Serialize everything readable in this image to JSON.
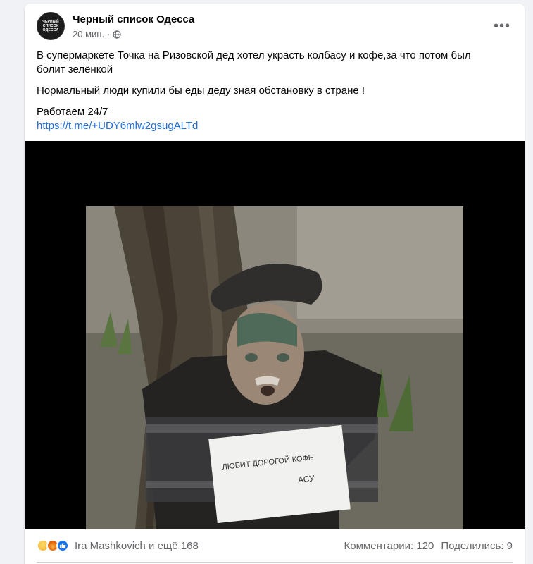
{
  "post": {
    "page_name": "Черный список Одесса",
    "avatar_text": [
      "ЧЕРНЫЙ",
      "СПИСОК",
      "ОДЕССА"
    ],
    "time": "20 мин.",
    "separator": "·",
    "privacy_icon": "globe-icon",
    "more_label": "•••",
    "text": {
      "paragraph1": "В супермаркете Точка на Ризовской дед хотел украсть колбасу и кофе,за что потом был болит зелёнкой",
      "paragraph2": "Нормальный люди купили бы еды деду зная обстановку в стране !",
      "paragraph3": "Работаем 24/7",
      "link": "https://t.me/+UDY6mlw2gsugALTd"
    },
    "video": {
      "sign_line1": "ЛЮБИТ ДОРОГОЙ КОФЕ",
      "sign_line2": "АСУ"
    }
  },
  "footer": {
    "reaction_icons": [
      "sad-icon",
      "angry-icon",
      "like-icon"
    ],
    "reactors": "Ira Mashkovich и ещё 168",
    "comments": "Комментарии: 120",
    "shares": "Поделились: 9"
  },
  "colors": {
    "link": "#216fdb",
    "meta": "#65676b",
    "background": "#f0f2f5"
  }
}
